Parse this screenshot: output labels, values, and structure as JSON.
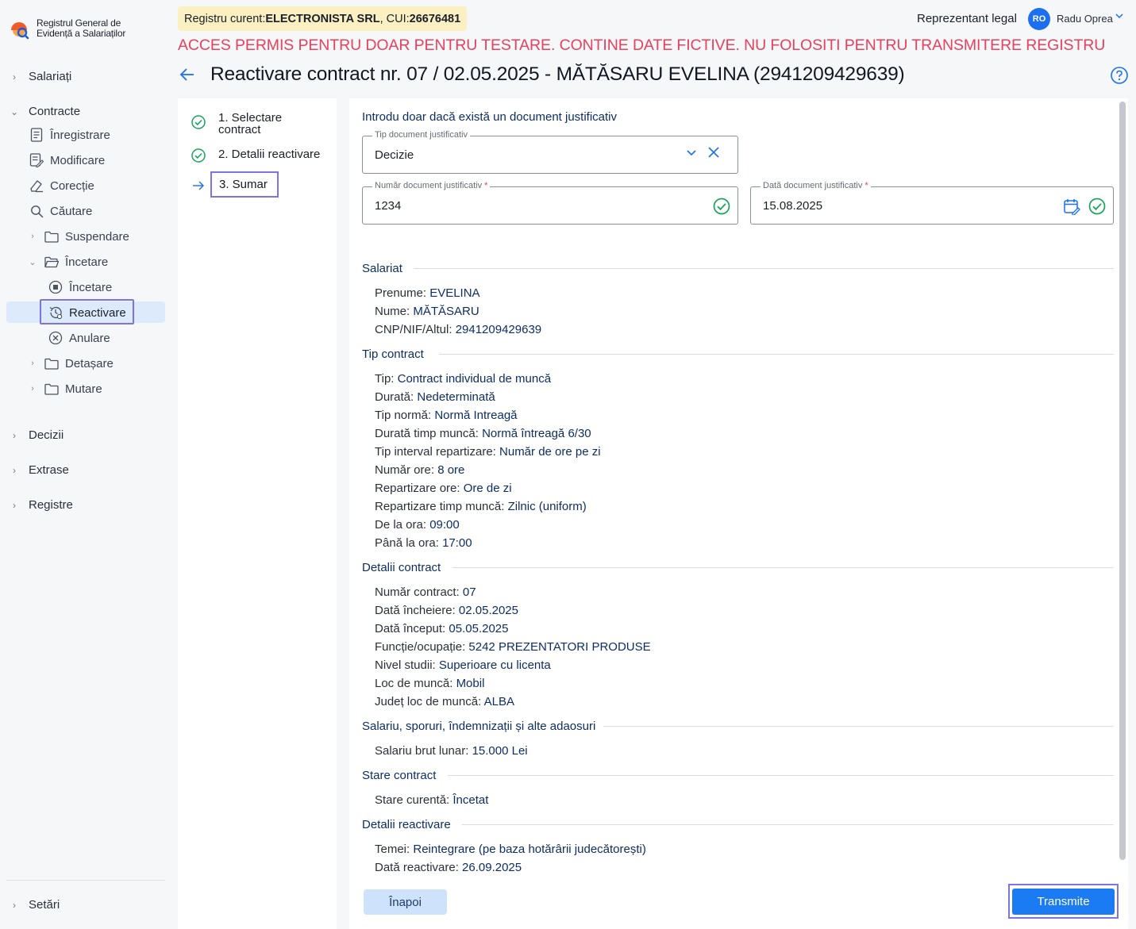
{
  "app": {
    "logo_line1": "Registrul General de",
    "logo_line2": "Evidență a Salariaților"
  },
  "sidebar": {
    "salariati": "Salariați",
    "contracte": "Contracte",
    "inregistrare": "Înregistrare",
    "modificare": "Modificare",
    "corectie": "Corecție",
    "cautare": "Căutare",
    "suspendare": "Suspendare",
    "incetare_folder": "Încetare",
    "incetare": "Încetare",
    "reactivare": "Reactivare",
    "anulare": "Anulare",
    "detasare": "Detașare",
    "mutare": "Mutare",
    "decizii": "Decizii",
    "extrase": "Extrase",
    "registre": "Registre",
    "setari": "Setări"
  },
  "header": {
    "registru_prefix": "Registru curent: ",
    "registru_name": "ELECTRONISTA SRL",
    "registru_cui_prefix": ", CUI: ",
    "registru_cui": "26676481",
    "warning": "ACCES PERMIS PENTRU DOAR PENTRU TESTARE. CONTINE DATE FICTIVE. NU FOLOSITI PENTRU TRANSMITERE REGISTRU",
    "role": "Reprezentant legal",
    "avatar_initials": "RO",
    "user_name": "Radu Oprea",
    "page_title": "Reactivare contract nr. 07 / 02.05.2025 - MĂTĂSARU  EVELINA (2941209429639)"
  },
  "stepper": {
    "step1_line1": "1. Selectare",
    "step1_line2": "contract",
    "step2": "2. Detalii reactivare",
    "step3": "3. Sumar"
  },
  "form": {
    "intro": "Introdu doar dacă există un document justificativ",
    "tip_label": "Tip document justificativ",
    "tip_value": "Decizie",
    "numar_label": "Număr document justificativ",
    "numar_value": "1234",
    "data_label": "Dată document justificativ",
    "data_value": "15.08.2025",
    "required_mark": "*"
  },
  "summary": {
    "salariat_title": "Salariat",
    "prenume_k": "Prenume: ",
    "prenume_v": "EVELINA",
    "nume_k": "Nume: ",
    "nume_v": "MĂTĂSARU",
    "cnp_k": "CNP/NIF/Altul: ",
    "cnp_v": "2941209429639",
    "tip_contract_title": "Tip contract",
    "tip_k": "Tip: ",
    "tip_v": "Contract individual de muncă",
    "durata_k": "Durată: ",
    "durata_v": "Nedeterminată",
    "tip_norma_k": "Tip normă: ",
    "tip_norma_v": "Normă Intreagă",
    "durata_timp_k": "Durată timp muncă: ",
    "durata_timp_v": "Normă întreagă 6/30",
    "tip_interval_k": "Tip interval repartizare: ",
    "tip_interval_v": "Număr de ore pe zi",
    "numar_ore_k": "Număr ore: ",
    "numar_ore_v": "8 ore",
    "repartizare_ore_k": "Repartizare ore: ",
    "repartizare_ore_v": "Ore de zi",
    "repartizare_timp_k": "Repartizare timp muncă: ",
    "repartizare_timp_v": "Zilnic (uniform)",
    "de_la_k": "De la ora: ",
    "de_la_v": "09:00",
    "pana_la_k": "Până la ora: ",
    "pana_la_v": "17:00",
    "detalii_contract_title": "Detalii contract",
    "nr_contract_k": "Număr contract: ",
    "nr_contract_v": "07",
    "data_incheiere_k": "Dată încheiere: ",
    "data_incheiere_v": "02.05.2025",
    "data_inceput_k": "Dată început: ",
    "data_inceput_v": "05.05.2025",
    "functie_k": "Funcție/ocupație: ",
    "functie_v": "5242 PREZENTATORI PRODUSE",
    "nivel_studii_k": "Nivel studii: ",
    "nivel_studii_v": "Superioare cu licenta",
    "loc_munca_k": "Loc de muncă: ",
    "loc_munca_v": "Mobil",
    "judet_k": "Județ loc de muncă: ",
    "judet_v": "ALBA",
    "salariu_title": "Salariu, sporuri, îndemnizații și alte adaosuri",
    "salariu_k": "Salariu brut lunar: ",
    "salariu_v": "15.000 Lei",
    "stare_title": "Stare contract",
    "stare_k": "Stare curentă: ",
    "stare_v": "Încetat",
    "reactivare_title": "Detalii reactivare",
    "temei_k": "Temei: ",
    "temei_v": "Reintegrare (pe baza hotărârii judecătorești)",
    "data_reactivare_k": "Dată reactivare: ",
    "data_reactivare_v": "26.09.2025"
  },
  "buttons": {
    "back": "Înapoi",
    "submit": "Transmite"
  },
  "colors": {
    "accent": "#1b7bf3",
    "warning": "#e9405d",
    "success": "#17a55a",
    "focus_outline": "#7b73e6"
  }
}
